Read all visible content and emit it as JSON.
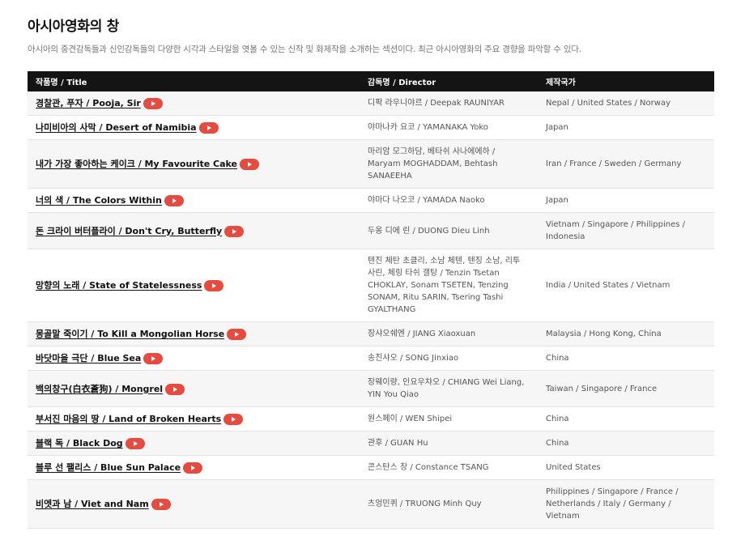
{
  "section": {
    "title": "아시아영화의 창",
    "description": "아시아의 중견감독들과 신인감독들의 다양한 시각과 스타일을 엿볼 수 있는 신작 및 화제작을 소개하는 섹션이다. 최근 아시아영화의 주요 경향을 파악할 수 있다."
  },
  "table": {
    "headers": {
      "title": "작품명 / Title",
      "director": "감독명 / Director",
      "country": "제작국가"
    },
    "rows": [
      {
        "title": "경찰관, 푸자 / Pooja, Sir",
        "director": "디팍 라우니야르 / Deepak RAUNIYAR",
        "country": "Nepal / United States / Norway"
      },
      {
        "title": "나미비아의 사막 / Desert of Namibia",
        "director": "야마나카 요코 / YAMANAKA Yoko",
        "country": "Japan"
      },
      {
        "title": "내가 가장 좋아하는 케이크 / My Favourite Cake",
        "director": "마리암 모그하담, 베타쉬 사나에에하 / Maryam MOGHADDAM, Behtash SANAEEHA",
        "country": "Iran / France / Sweden / Germany"
      },
      {
        "title": "너의 색 / The Colors Within",
        "director": "야마다 나오코 / YAMADA Naoko",
        "country": "Japan"
      },
      {
        "title": "돈 크라이 버터플라이 / Don't Cry, Butterfly",
        "director": "두옹 디에 린 / DUONG Dieu Linh",
        "country": "Vietnam / Singapore / Philippines / Indonesia"
      },
      {
        "title": "망향의 노래 / State of Statelessness",
        "director": "텐진 체탄 초클리, 소남 체텐, 텐징 소남, 리투 사린, 체링 타쉬 갤탕 / Tenzin Tsetan CHOKLAY, Sonam TSETEN, Tenzing SONAM, Ritu SARIN, Tsering Tashi GYALTHANG",
        "country": "India / United States / Vietnam"
      },
      {
        "title": "몽골말 죽이기 / To Kill a Mongolian Horse",
        "director": "장샤오쉐엔 / JIANG Xiaoxuan",
        "country": "Malaysia / Hong Kong, China"
      },
      {
        "title": "바닷마을 극단 / Blue Sea",
        "director": "송진샤오 / SONG Jinxiao",
        "country": "China"
      },
      {
        "title": "백의창구(白衣蒼狗) / Mongrel",
        "director": "장웨이량, 인요우챠오 / CHIANG Wei Liang, YIN You Qiao",
        "country": "Taiwan / Singapore / France"
      },
      {
        "title": "부서진 마음의 땅 / Land of Broken Hearts",
        "director": "원스페이 / WEN Shipei",
        "country": "China"
      },
      {
        "title": "블랙 독 / Black Dog",
        "director": "관후 / GUAN Hu",
        "country": "China"
      },
      {
        "title": "블루 선 팰리스 / Blue Sun Palace",
        "director": "콘스탄스 창 / Constance TSANG",
        "country": "United States"
      },
      {
        "title": "비엣과 남 / Viet and Nam",
        "director": "츠엉민퀴 / TRUONG Minh Quy",
        "country": "Philippines / Singapore / France / Netherlands / Italy / Germany / Vietnam"
      }
    ]
  },
  "icons": {
    "play": "play-icon"
  },
  "colors": {
    "header_bg": "#141414",
    "play_button": "#e64b3f",
    "row_alt": "#f6f6f6"
  }
}
